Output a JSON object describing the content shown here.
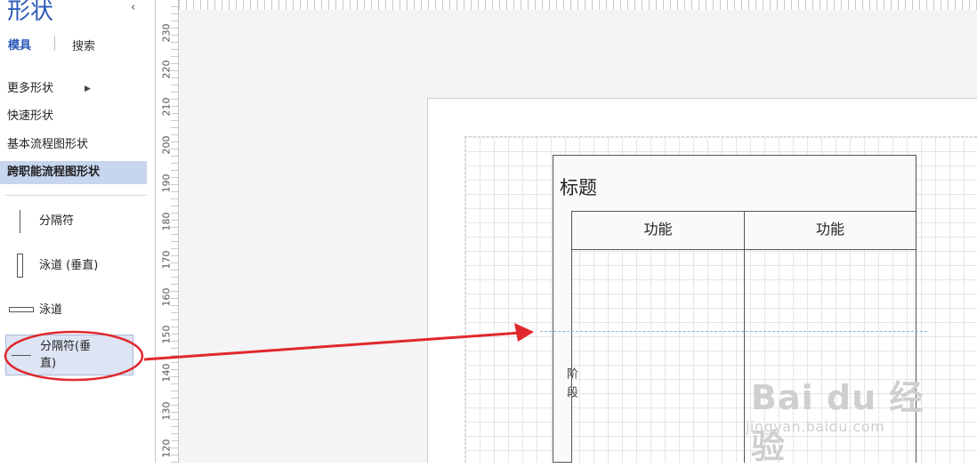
{
  "panel": {
    "title": "形状",
    "collapse_glyph": "‹",
    "tabs": [
      "模具",
      "搜索"
    ],
    "categories": [
      "更多形状",
      "快速形状",
      "基本流程图形状",
      "跨职能流程图形状"
    ],
    "selected_category": "跨职能流程图形状",
    "shapes": [
      "分隔符",
      "泳道 (垂直)",
      "泳道",
      "分隔符(垂\n直)"
    ]
  },
  "ruler": {
    "labels": [
      "230",
      "220",
      "210",
      "200",
      "190",
      "180",
      "170",
      "160",
      "150",
      "140",
      "130",
      "120"
    ]
  },
  "diagram": {
    "title": "标题",
    "lanes": [
      "功能",
      "功能"
    ],
    "phase_label": "阶段"
  },
  "watermark": {
    "logo": "Bai du 经验",
    "url": "jingyan.baidu.com"
  },
  "colors": {
    "accent": "#2b58b8",
    "selected_bg": "#c7d5ef",
    "annotation": "#e0282d",
    "separator": "#7fb4d6"
  }
}
